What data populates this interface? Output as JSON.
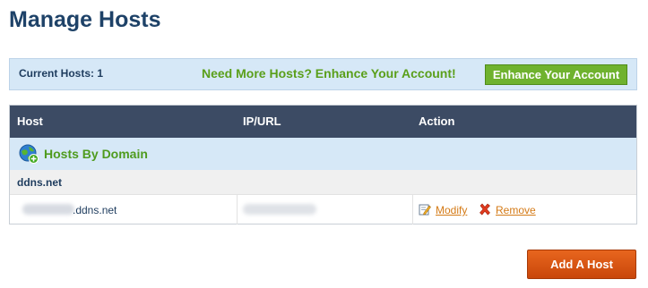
{
  "page": {
    "title": "Manage Hosts"
  },
  "info_bar": {
    "current_hosts": "Current Hosts: 1",
    "promo": "Need More Hosts? Enhance Your Account!",
    "enhance_button": "Enhance Your Account"
  },
  "table": {
    "columns": [
      "Host",
      "IP/URL",
      "Action"
    ],
    "group_label": "Hosts By Domain",
    "domain": "ddns.net",
    "rows": [
      {
        "hostname_suffix": ".ddns.net",
        "modify_label": "Modify",
        "remove_label": "Remove"
      }
    ]
  },
  "actions": {
    "add_host": "Add A Host"
  },
  "colors": {
    "title": "#1e4268",
    "header_bg": "#3c4b64",
    "info_bg": "#d6e8f7",
    "accent_green": "#6fb22e",
    "link_orange": "#d47a16",
    "add_button": "#d9551a"
  },
  "icons": {
    "group": "globe-add-icon",
    "modify": "edit-pencil-icon",
    "remove": "red-x-icon"
  }
}
